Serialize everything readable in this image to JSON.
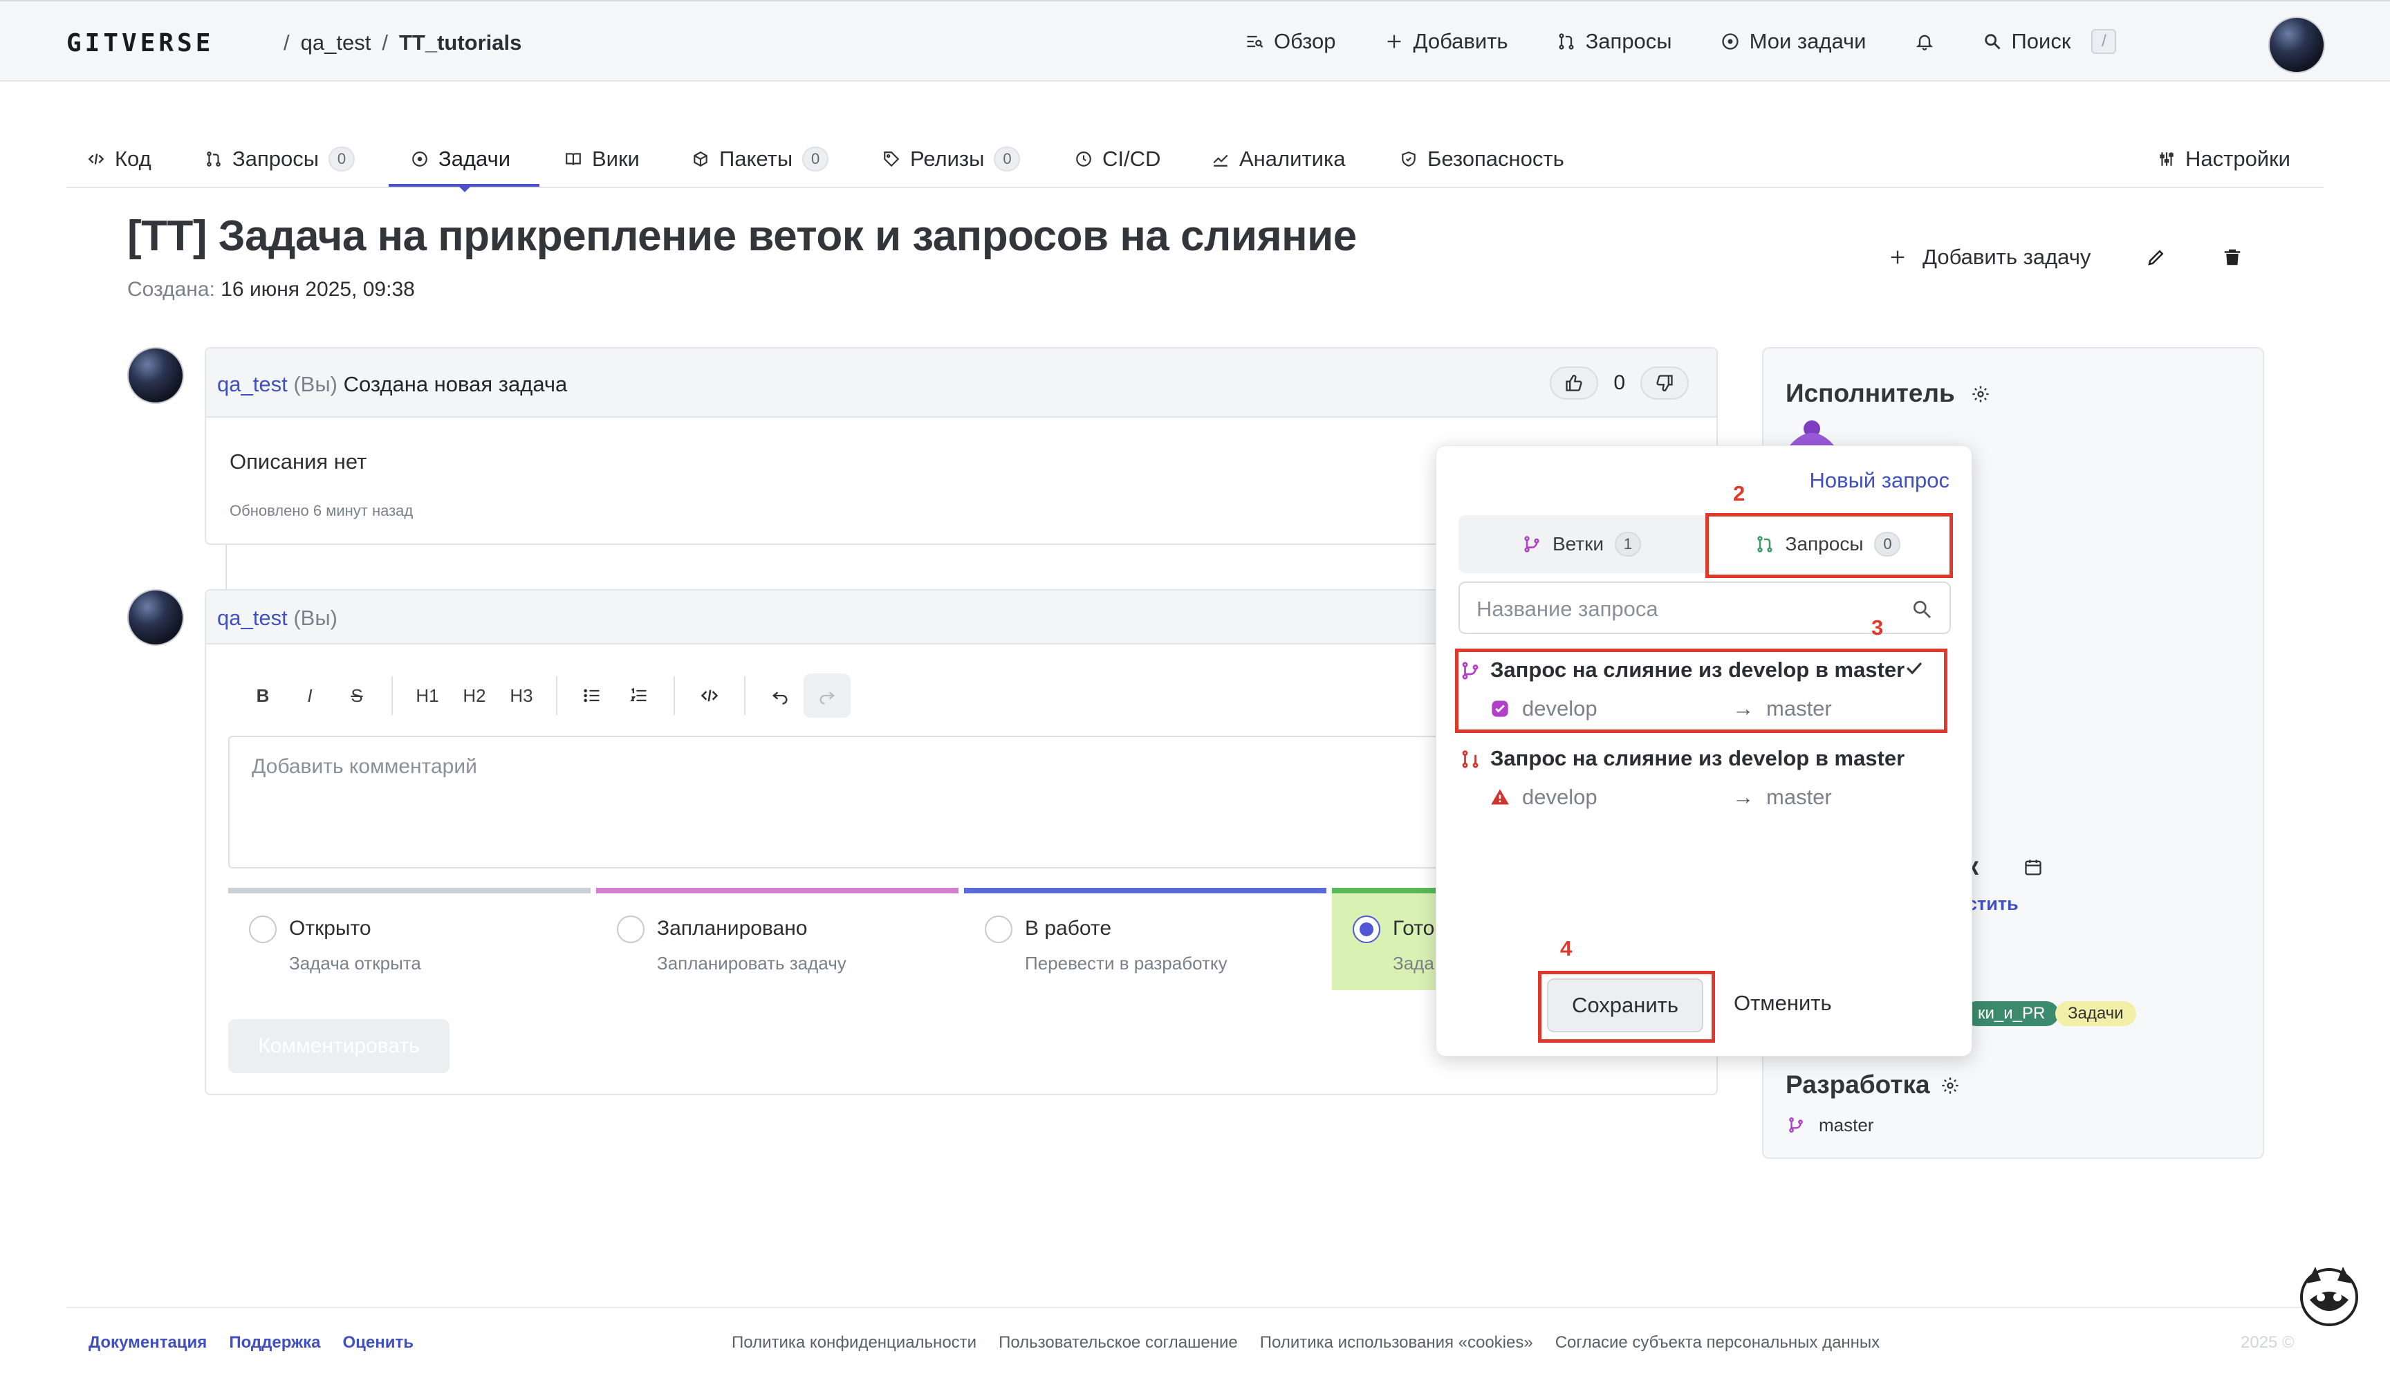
{
  "header": {
    "logo": "GITVERSE",
    "breadcrumb": [
      "qa_test",
      "TT_tutorials"
    ],
    "separator": "/",
    "nav": [
      {
        "label": "Обзор",
        "icon": "overview-icon"
      },
      {
        "label": "Добавить",
        "icon": "plus-icon"
      },
      {
        "label": "Запросы",
        "icon": "pull-request-icon"
      },
      {
        "label": "Мои задачи",
        "icon": "issue-icon"
      }
    ],
    "search_label": "Поиск",
    "search_shortcut": "/"
  },
  "repo_tabs": [
    {
      "label": "Код",
      "icon": "code-icon",
      "count": null
    },
    {
      "label": "Запросы",
      "icon": "pull-request-icon",
      "count": "0"
    },
    {
      "label": "Задачи",
      "icon": "issue-icon",
      "count": null,
      "active": true
    },
    {
      "label": "Вики",
      "icon": "book-icon",
      "count": null
    },
    {
      "label": "Пакеты",
      "icon": "package-icon",
      "count": "0"
    },
    {
      "label": "Релизы",
      "icon": "tag-icon",
      "count": "0"
    },
    {
      "label": "CI/CD",
      "icon": "cicd-icon",
      "count": null
    },
    {
      "label": "Аналитика",
      "icon": "chart-icon",
      "count": null
    },
    {
      "label": "Безопасность",
      "icon": "shield-icon",
      "count": null
    }
  ],
  "settings_label": "Настройки",
  "issue": {
    "title": "[TT] Задача на прикрепление веток и запросов на слияние",
    "created_label": "Создана:",
    "created_value": "16 июня 2025, 09:38",
    "add_task": "Добавить задачу"
  },
  "comment": {
    "author": "qa_test",
    "you": "(Вы)",
    "text": "Создана новая задача",
    "likes": "0",
    "description": "Описания нет",
    "updated": "Обновлено 6 минут назад"
  },
  "editor": {
    "author": "qa_test",
    "you": "(Вы)",
    "toolbar": [
      "B",
      "I",
      "S",
      "H1",
      "H2",
      "H3"
    ],
    "placeholder": "Добавить комментарий",
    "submit": "Комментировать",
    "statuses": [
      {
        "name": "Открыто",
        "sub": "Задача открыта",
        "color": "#cbd0d6"
      },
      {
        "name": "Запланировано",
        "sub": "Запланировать задачу",
        "color": "#d47fd0"
      },
      {
        "name": "В работе",
        "sub": "Перевести в разработку",
        "color": "#5a6bd8"
      },
      {
        "name": "Гото",
        "sub": "Зада",
        "color": "#58b857",
        "selected": true
      }
    ]
  },
  "sidebar": {
    "assignee_title": "Исполнитель",
    "assignee_partial": "",
    "deadline_partial": "ок",
    "deadline_link_partial": "стить",
    "labels": [
      "ки_и_PR",
      "Задачи"
    ],
    "dev_title": "Разработка",
    "dev_branch": "master"
  },
  "popover": {
    "new_request": "Новый запрос",
    "tabs": [
      {
        "label": "Ветки",
        "count": "1"
      },
      {
        "label": "Запросы",
        "count": "0"
      }
    ],
    "search_placeholder": "Название запроса",
    "requests": [
      {
        "title": "Запрос на слияние из develop в master",
        "source": "develop",
        "target": "master",
        "checked": true,
        "status": "ok"
      },
      {
        "title": "Запрос на слияние из develop в master",
        "source": "develop",
        "target": "master",
        "checked": false,
        "status": "error"
      }
    ],
    "save": "Сохранить",
    "cancel": "Отменить"
  },
  "annotations": [
    "2",
    "3",
    "4"
  ],
  "footer": {
    "links": [
      "Документация",
      "Поддержка",
      "Оценить"
    ],
    "legal": [
      "Политика конфиденциальности",
      "Пользовательское соглашение",
      "Политика использования «cookies»",
      "Согласие субъекта персональных данных"
    ],
    "copyright": "2025 ©"
  },
  "colors": {
    "accent": "#4050c0",
    "highlight": "#e0392b",
    "branch": "#b040c8"
  }
}
